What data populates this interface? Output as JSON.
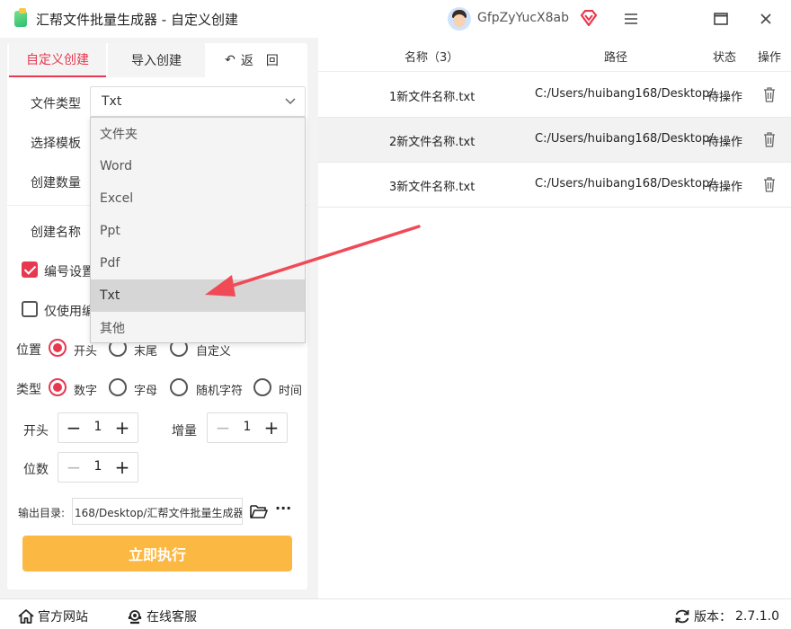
{
  "window": {
    "title": "汇帮文件批量生成器 - 自定义创建",
    "username": "GfpZyYucX8ab",
    "minimize_symbol": "☰"
  },
  "left": {
    "tabs": {
      "custom": "自定义创建",
      "import": "导入创建",
      "back": "返　回",
      "back_icon": "↶"
    },
    "labels": {
      "file_type": "文件类型",
      "template": "选择模板",
      "count": "创建数量",
      "name": "创建名称",
      "numbering": "编号设置",
      "only_number": "仅使用编"
    },
    "file_type_value": "Txt",
    "dropdown_options": [
      "文件夹",
      "Word",
      "Excel",
      "Ppt",
      "Pdf",
      "Txt",
      "其他"
    ],
    "dropdown_selected": "Txt",
    "position": {
      "label": "位置",
      "options": [
        "开头",
        "末尾",
        "自定义"
      ],
      "selected": "开头"
    },
    "type": {
      "label": "类型",
      "options": [
        "数字",
        "字母",
        "随机字符",
        "时间"
      ],
      "selected": "数字"
    },
    "start": {
      "label": "开头",
      "value": "1"
    },
    "increment": {
      "label": "增量",
      "value": "1"
    },
    "digits": {
      "label": "位数",
      "value": "1"
    },
    "output": {
      "label": "输出目录:",
      "value": "168/Desktop/汇帮文件批量生成器"
    },
    "run_button": "立即执行"
  },
  "table": {
    "headers": {
      "name": "名称（3）",
      "path": "路径",
      "status": "状态",
      "action": "操作"
    },
    "rows": [
      {
        "name": "1新文件名称.txt",
        "path": "C:/Users/huibang168/Desktop/",
        "status": "待操作"
      },
      {
        "name": "2新文件名称.txt",
        "path": "C:/Users/huibang168/Desktop/",
        "status": "待操作"
      },
      {
        "name": "3新文件名称.txt",
        "path": "C:/Users/huibang168/Desktop/",
        "status": "待操作"
      }
    ]
  },
  "statusbar": {
    "website": "官方网站",
    "support": "在线客服",
    "version_label": "版本：",
    "version": "2.7.1.0"
  },
  "colors": {
    "accent": "#e8384f",
    "run_button": "#fbb843",
    "arrow": "#f04a56"
  }
}
